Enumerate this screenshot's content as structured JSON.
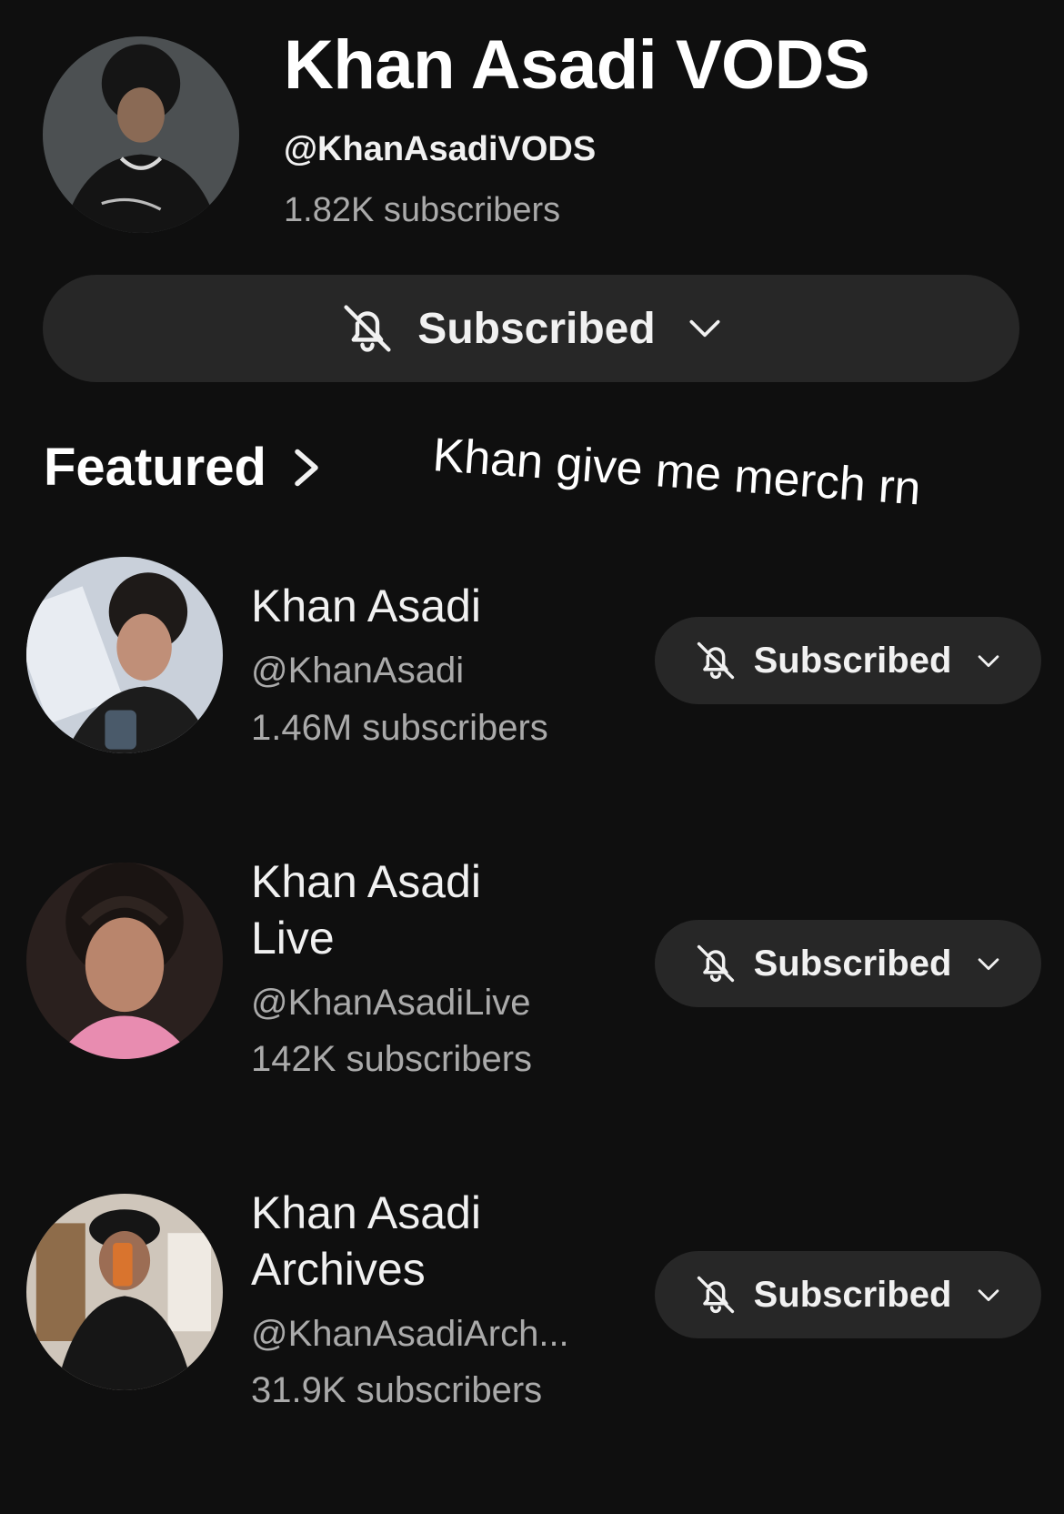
{
  "channel": {
    "title": "Khan Asadi VODS",
    "handle": "@KhanAsadiVODS",
    "subscribers": "1.82K subscribers",
    "subscribe_label": "Subscribed"
  },
  "overlay_text": "Khan give me merch rn",
  "featured": {
    "label": "Featured",
    "channels": [
      {
        "name_line1": "Khan Asadi",
        "name_line2": "",
        "handle": "@KhanAsadi",
        "subscribers": "1.46M subscribers",
        "subscribe_label": "Subscribed"
      },
      {
        "name_line1": "Khan Asadi",
        "name_line2": "Live",
        "handle": "@KhanAsadiLive",
        "subscribers": "142K subscribers",
        "subscribe_label": "Subscribed"
      },
      {
        "name_line1": "Khan Asadi",
        "name_line2": "Archives",
        "handle": "@KhanAsadiArch...",
        "subscribers": "31.9K subscribers",
        "subscribe_label": "Subscribed"
      }
    ]
  },
  "icons": {
    "bell": "bell-off-icon",
    "chevron": "chevron-down-icon",
    "featured_arrow": "chevron-right-icon"
  },
  "colors": {
    "background": "#0f0f0f",
    "button_bg": "#272727",
    "primary_text": "#f1f1f1",
    "secondary_text": "#aaaaaa"
  }
}
